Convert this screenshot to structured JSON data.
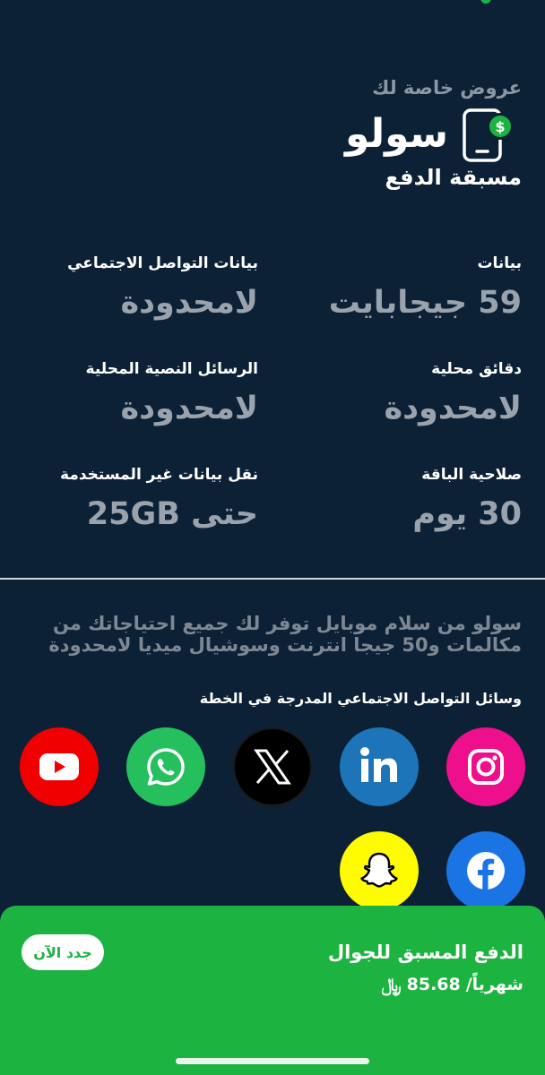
{
  "header": {
    "special_offers": "عروض خاصة لك",
    "brand": "سولو",
    "plan_type": "مسبقة الدفع"
  },
  "features": [
    {
      "label": "بيانات",
      "value": "59 جيجابايت"
    },
    {
      "label": "بيانات التواصل الاجتماعي",
      "value": "لامحدودة"
    },
    {
      "label": "دقائق محلية",
      "value": "لامحدودة"
    },
    {
      "label": "الرسائل النصية المحلية",
      "value": "لامحدودة"
    },
    {
      "label": "صلاحية الباقة",
      "value": "30 يوم"
    },
    {
      "label": "نقل بيانات غير المستخدمة",
      "value": "حتى 25GB"
    }
  ],
  "description": "سولو من سلام موبايل توفر لك جميع احتياجاتك من مكالمات و50 جيجا انترنت وسوشيال ميديا لامحدودة",
  "social_title": "وسائل التواصل الاجتماعي المدرجة في الخطة",
  "social_icons": [
    "instagram-icon",
    "linkedin-icon",
    "x-icon",
    "whatsapp-icon",
    "youtube-icon",
    "facebook-icon",
    "snapchat-icon"
  ],
  "colors": {
    "background": "#0d2136",
    "accent_green": "#1db341",
    "value_gray": "#9aa3ad",
    "instagram": "#ee0f8c",
    "linkedin": "#1d74b8",
    "x": "#000000",
    "whatsapp": "#25c05d",
    "youtube": "#f00000",
    "facebook": "#1b74e4",
    "snapchat": "#fffb00"
  },
  "bottom_bar": {
    "plan_name": "الدفع المسبق للجوال",
    "price": "85.68",
    "currency_symbol": "﷼",
    "period": "شهرياً/",
    "renew_label": "جدد الآن"
  }
}
